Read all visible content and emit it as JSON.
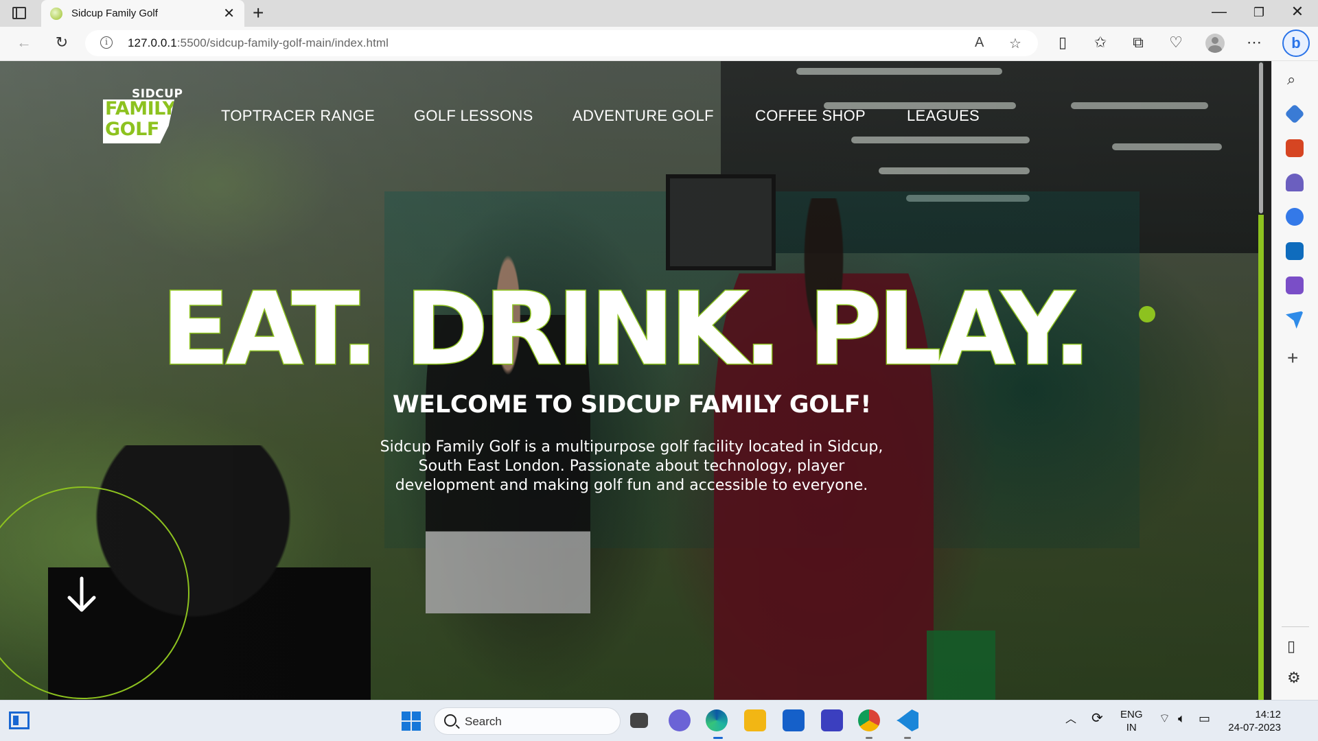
{
  "browser": {
    "tab_title": "Sidcup Family Golf",
    "url_host": "127.0.0.1",
    "url_path": ":5500/sidcup-family-golf-main/index.html"
  },
  "page": {
    "logo": {
      "top": "SIDCUP",
      "line1": "FAMILY",
      "line2": "GOLF"
    },
    "nav": [
      "TOPTRACER RANGE",
      "GOLF LESSONS",
      "ADVENTURE GOLF",
      "COFFEE SHOP",
      "LEAGUES"
    ],
    "headline": "EAT. DRINK. PLAY.",
    "welcome": "WELCOME TO SIDCUP FAMILY GOLF!",
    "description": "Sidcup Family Golf is a multipurpose golf facility located in Sidcup, South East London. Passionate about technology, player development and making golf fun and accessible to everyone.",
    "accent_color": "#8dc21f"
  },
  "taskbar": {
    "search_label": "Search",
    "lang_top": "ENG",
    "lang_bottom": "IN",
    "time": "14:12",
    "date": "24-07-2023"
  }
}
